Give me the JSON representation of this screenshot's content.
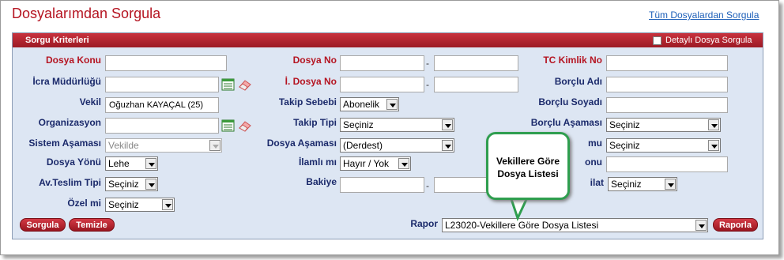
{
  "page": {
    "title": "Dosyalarımdan Sorgula",
    "all_files_link": "Tüm Dosyalardan Sorgula"
  },
  "panel": {
    "title": "Sorgu Kriterleri",
    "detailed_label": "Detaylı Dosya Sorgula"
  },
  "labels": {
    "dosya_konu": "Dosya Konu",
    "icra_mudurlugu": "İcra Müdürlüğü",
    "vekil": "Vekil",
    "organizasyon": "Organizasyon",
    "sistem_asamasi": "Sistem Aşaması",
    "dosya_yonu": "Dosya Yönü",
    "av_teslim_tipi": "Av.Teslim Tipi",
    "ozel_mi": "Özel mi",
    "dosya_no": "Dosya No",
    "i_dosya_no": "İ. Dosya No",
    "takip_sebebi": "Takip Sebebi",
    "takip_tipi": "Takip Tipi",
    "dosya_asamasi": "Dosya Aşaması",
    "ilamli_mi": "İlamlı mı",
    "bakiye": "Bakiye",
    "tc_kimlik_no": "TC Kimlik No",
    "borclu_adi": "Borçlu Adı",
    "borclu_soyadi": "Borçlu Soyadı",
    "borclu_asamasi": "Borçlu Aşaması",
    "partial_mu": "mu",
    "partial_nu": "onu",
    "partial_ilat": "ilat",
    "rapor": "Rapor"
  },
  "values": {
    "vekil": "Oğuzhan KAYAÇAL (25)",
    "sistem_asamasi": "Vekilde",
    "dosya_yonu": "Lehe",
    "av_teslim_tipi": "Seçiniz",
    "ozel_mi": "Seçiniz",
    "takip_sebebi": "Abonelik",
    "takip_tipi": "Seçiniz",
    "dosya_asamasi": "(Derdest)",
    "ilamli_mi": "Hayır / Yok",
    "borclu_asamasi": "Seçiniz",
    "partial_mu_select": "Seçiniz",
    "partial_ilat_select": "Seçiniz",
    "rapor": "L23020-Vekillere Göre Dosya Listesi"
  },
  "dash": "-",
  "buttons": {
    "sorgula": "Sorgula",
    "temizle": "Temizle",
    "raporla": "Raporla"
  },
  "callout": {
    "line1": "Vekillere Göre",
    "line2": "Dosya Listesi"
  },
  "colors": {
    "accent": "#b51421",
    "label": "#1b2a6b",
    "panel_bg": "#dde6f3",
    "callout_border": "#2f9e4f"
  },
  "icons": {
    "list": "list-icon",
    "eraser": "eraser-icon"
  }
}
